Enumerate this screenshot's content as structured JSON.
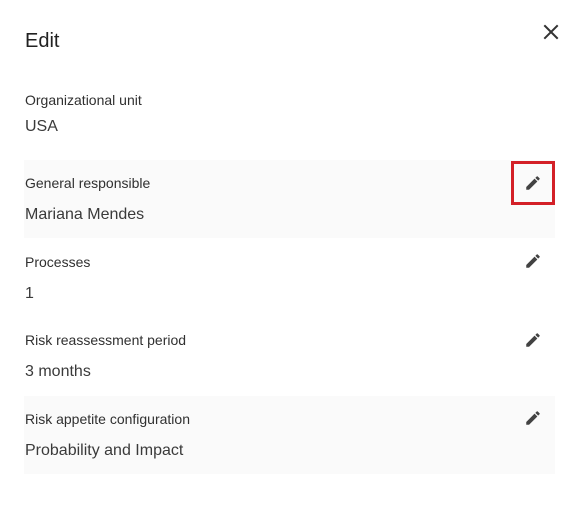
{
  "dialog": {
    "title": "Edit",
    "close_icon": "close-icon"
  },
  "fields": [
    {
      "label": "Organizational unit",
      "value": "USA",
      "editable": false
    },
    {
      "label": "General responsible",
      "value": "Mariana Mendes",
      "editable": true,
      "icon": "pencil-icon",
      "highlighted": true
    },
    {
      "label": "Processes",
      "value": "1",
      "editable": true,
      "icon": "pencil-icon"
    },
    {
      "label": "Risk reassessment period",
      "value": "3 months",
      "editable": true,
      "icon": "pencil-icon"
    },
    {
      "label": "Risk appetite configuration",
      "value": "Probability and Impact",
      "editable": true,
      "icon": "pencil-icon"
    }
  ],
  "colors": {
    "highlight_border": "#d32027",
    "shaded_row": "#fafafa",
    "icon": "#424242"
  }
}
